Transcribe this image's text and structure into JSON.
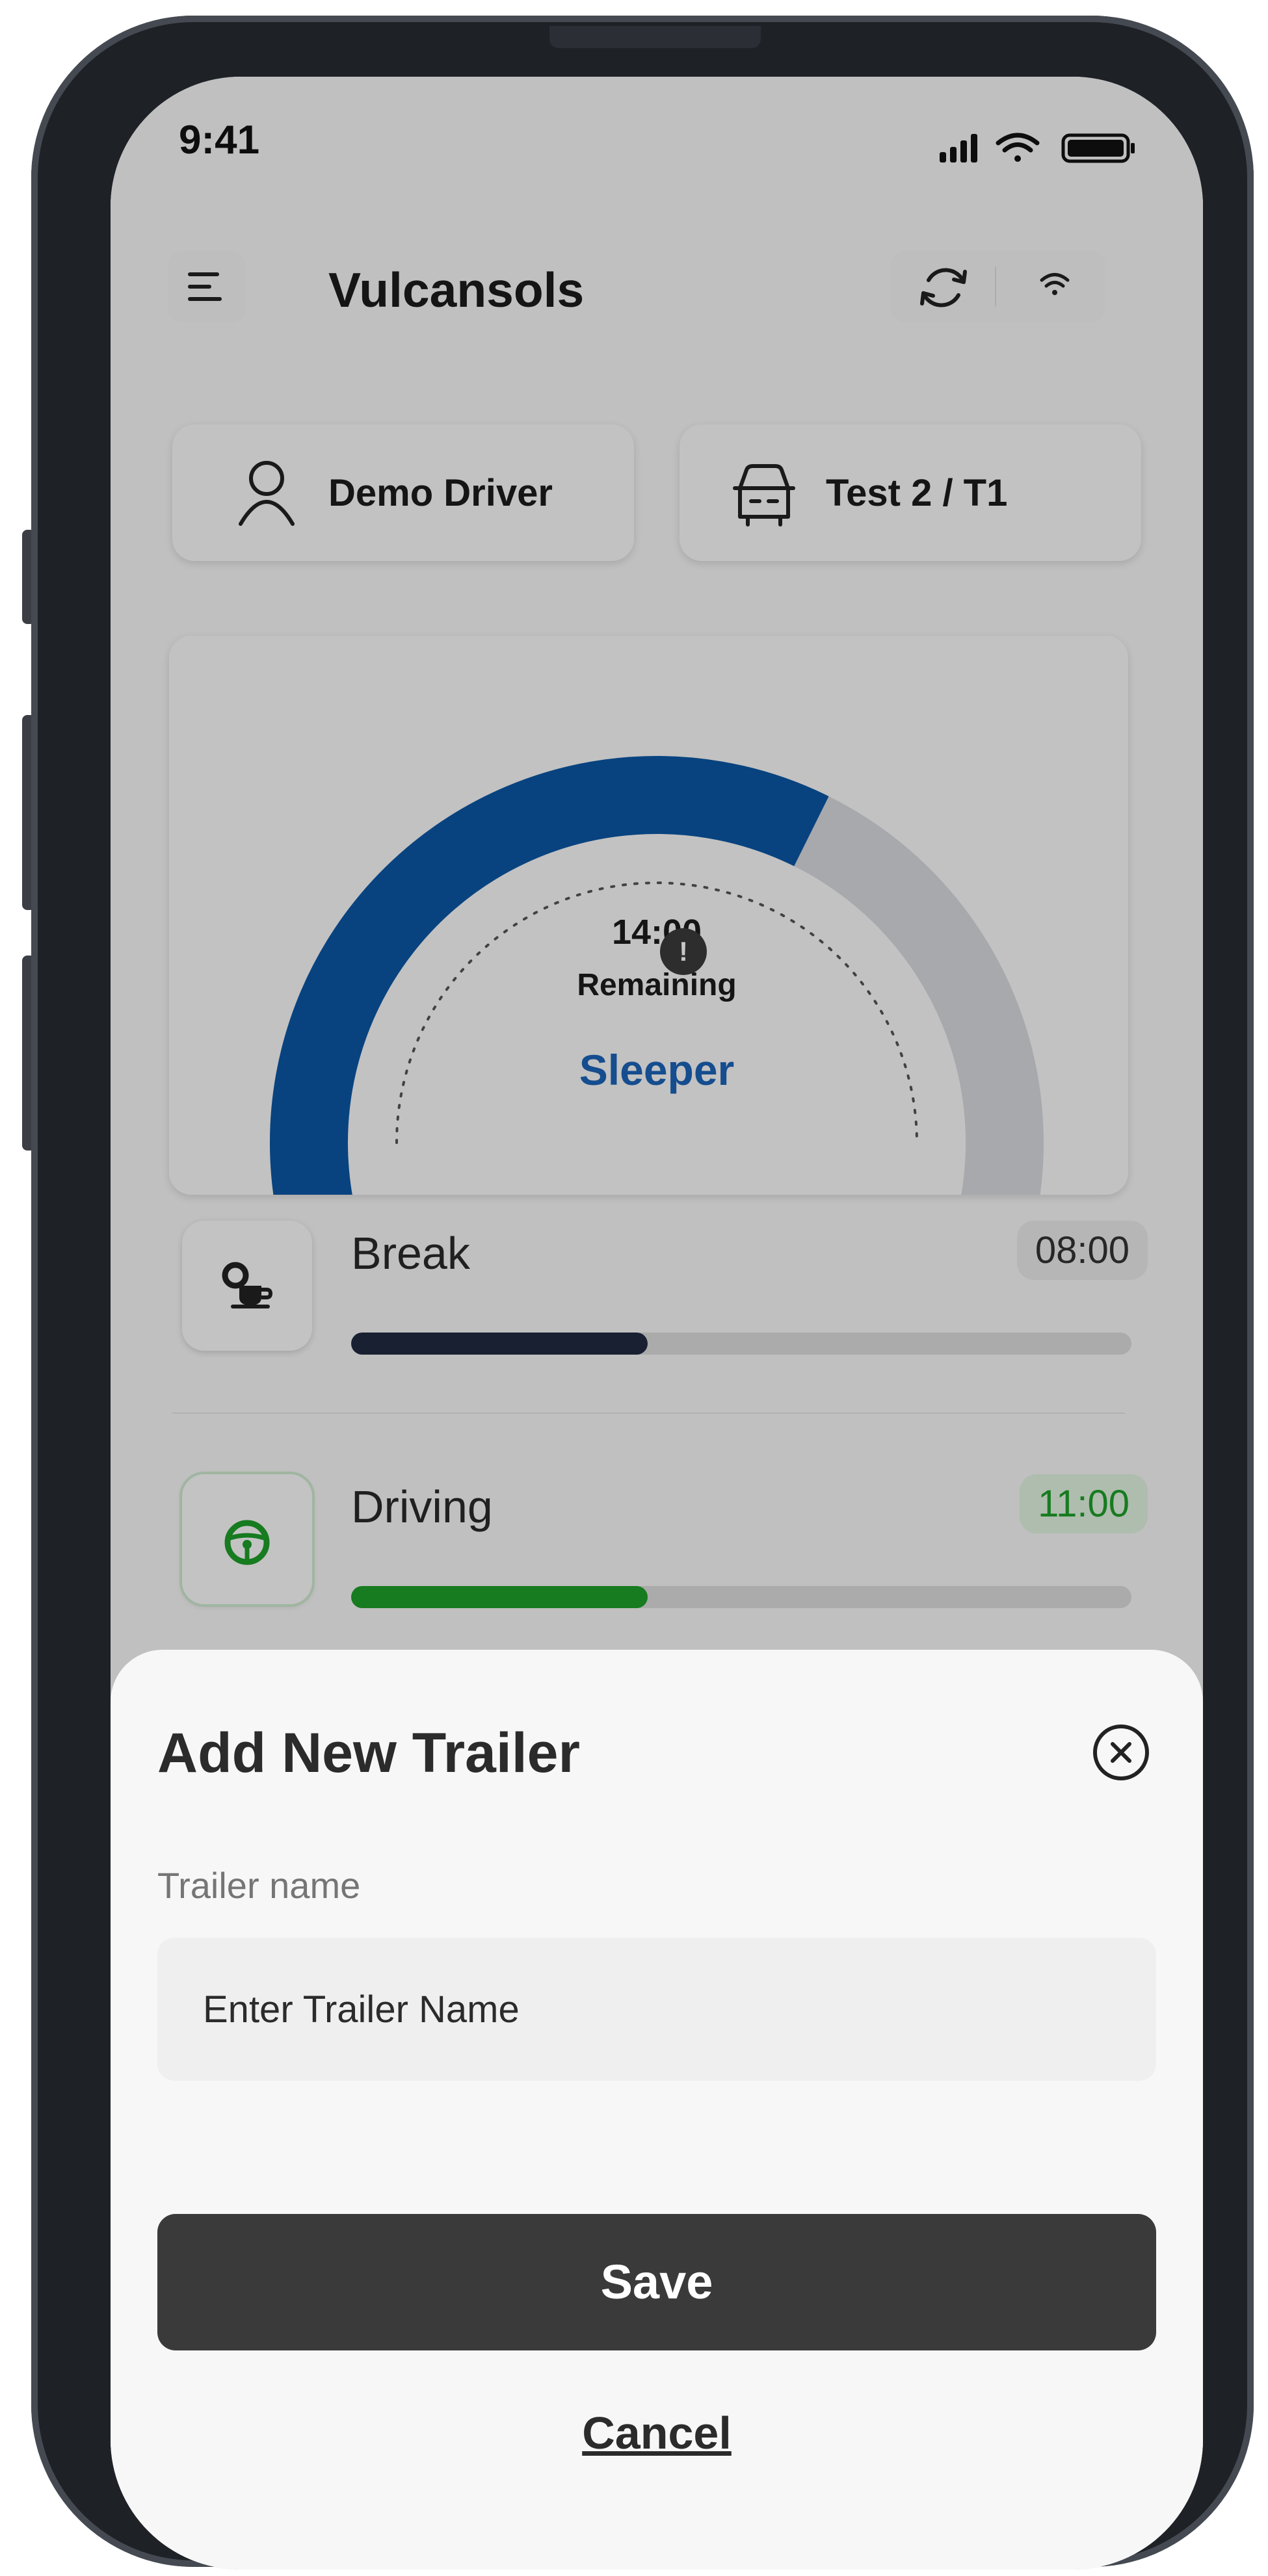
{
  "status_bar": {
    "time": "9:41"
  },
  "header": {
    "title": "Vulcansols"
  },
  "driver": {
    "name": "Demo Driver"
  },
  "vehicle": {
    "name": "Test 2 / T1"
  },
  "gauge": {
    "time": "14:00",
    "remaining_label": "Remaining",
    "status": "Sleeper",
    "fill_fraction": 0.62
  },
  "activities": [
    {
      "label": "Break",
      "time": "08:00",
      "progress": 0.38,
      "color": "#1f2940"
    },
    {
      "label": "Driving",
      "time": "11:00",
      "progress": 0.38,
      "color": "#1e9e2a"
    }
  ],
  "sheet": {
    "title": "Add New Trailer",
    "field_label": "Trailer name",
    "field_placeholder": "Enter Trailer Name",
    "save_label": "Save",
    "cancel_label": "Cancel"
  },
  "colors": {
    "accent_blue": "#0b56a4",
    "status_blue": "#1b63b8",
    "driving_green": "#1e9e2a"
  },
  "icons": [
    "menu-icon",
    "sync-icon",
    "wifi-icon",
    "user-icon",
    "truck-icon",
    "info-icon",
    "break-icon",
    "steering-wheel-icon",
    "close-icon",
    "signal-icon",
    "battery-icon"
  ]
}
